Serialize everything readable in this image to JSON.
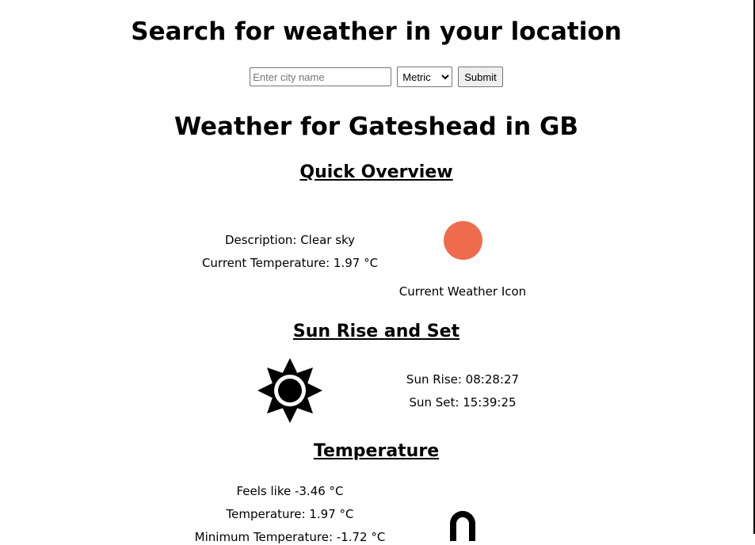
{
  "header": {
    "title": "Search for weather in your location"
  },
  "search": {
    "city_placeholder": "Enter city name",
    "city_value": "",
    "units_selected": "Metric",
    "submit_label": "Submit"
  },
  "location": {
    "title": "Weather for Gateshead in GB"
  },
  "overview": {
    "title": "Quick Overview",
    "description": "Description: Clear sky",
    "current_temp": "Current Temperature: 1.97 °C",
    "icon_label": "Current Weather Icon",
    "icon_color": "#ee6c4d"
  },
  "sun": {
    "title": "Sun Rise and Set",
    "icon": "sun-icon",
    "sunrise": "Sun Rise: 08:28:27",
    "sunset": "Sun Set: 15:39:25"
  },
  "temperature": {
    "title": "Temperature",
    "icon": "thermometer-icon",
    "feels_like": "Feels like -3.46 °C",
    "temperature": "Temperature: 1.97 °C",
    "min_temp": "Minimum Temperature: -1.72 °C"
  }
}
